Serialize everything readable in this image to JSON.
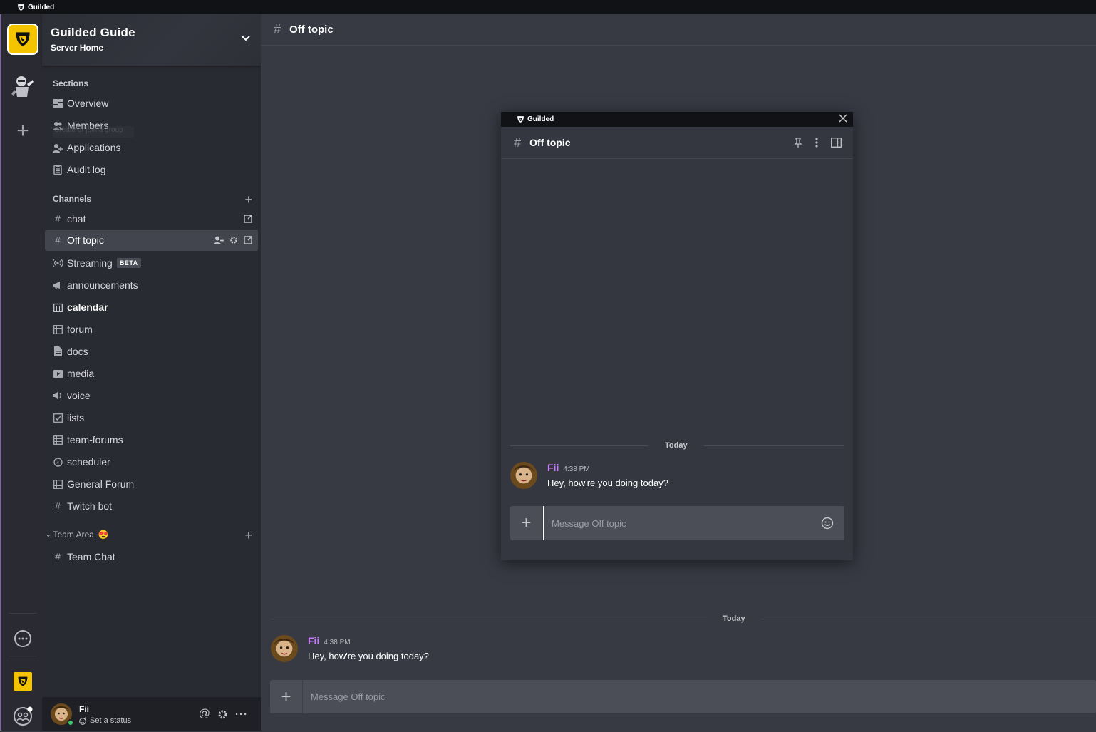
{
  "titlebar": {
    "app_name": "Guilded"
  },
  "server": {
    "name": "Guilded Guide",
    "subtitle": "Server Home"
  },
  "sections": {
    "label": "Sections",
    "items": [
      {
        "label": "Overview",
        "icon": "dashboard-icon"
      },
      {
        "label": "Members",
        "icon": "members-icon"
      },
      {
        "label": "Applications",
        "icon": "add-user-icon"
      },
      {
        "label": "Audit log",
        "icon": "clipboard-icon"
      }
    ],
    "ghost_tooltip": "Create or join a group"
  },
  "channels": {
    "label": "Channels",
    "items": [
      {
        "label": "chat",
        "icon": "hash-icon"
      },
      {
        "label": "Off topic",
        "icon": "hash-icon",
        "active": true
      },
      {
        "label": "Streaming",
        "icon": "broadcast-icon",
        "badge": "BETA"
      },
      {
        "label": "announcements",
        "icon": "megaphone-icon"
      },
      {
        "label": "calendar",
        "icon": "calendar-icon",
        "bold": true
      },
      {
        "label": "forum",
        "icon": "forum-icon"
      },
      {
        "label": "docs",
        "icon": "document-icon"
      },
      {
        "label": "media",
        "icon": "media-icon"
      },
      {
        "label": "voice",
        "icon": "speaker-icon"
      },
      {
        "label": "lists",
        "icon": "checklist-icon"
      },
      {
        "label": "team-forums",
        "icon": "forum-icon"
      },
      {
        "label": "scheduler",
        "icon": "clock-icon"
      },
      {
        "label": "General Forum",
        "icon": "forum-icon"
      },
      {
        "label": "Twitch bot",
        "icon": "hash-icon"
      }
    ]
  },
  "team_area": {
    "label": "Team Area",
    "emoji": "😍",
    "items": [
      {
        "label": "Team Chat",
        "icon": "hash-icon"
      }
    ]
  },
  "user": {
    "name": "Fii",
    "status": "Set a status"
  },
  "main": {
    "channel_title": "Off topic",
    "day_separator": "Today",
    "message": {
      "author": "Fii",
      "time": "4:38 PM",
      "text": "Hey, how're you doing today?"
    },
    "composer_placeholder": "Message Off topic"
  },
  "popout": {
    "app_name": "Guilded",
    "channel_title": "Off topic",
    "day_separator": "Today",
    "message": {
      "author": "Fii",
      "time": "4:38 PM",
      "text": "Hey, how're you doing today?"
    },
    "composer_placeholder": "Message Off topic"
  },
  "colors": {
    "accent": "#f5c400",
    "author": "#c77dff",
    "online": "#3fc76b"
  }
}
